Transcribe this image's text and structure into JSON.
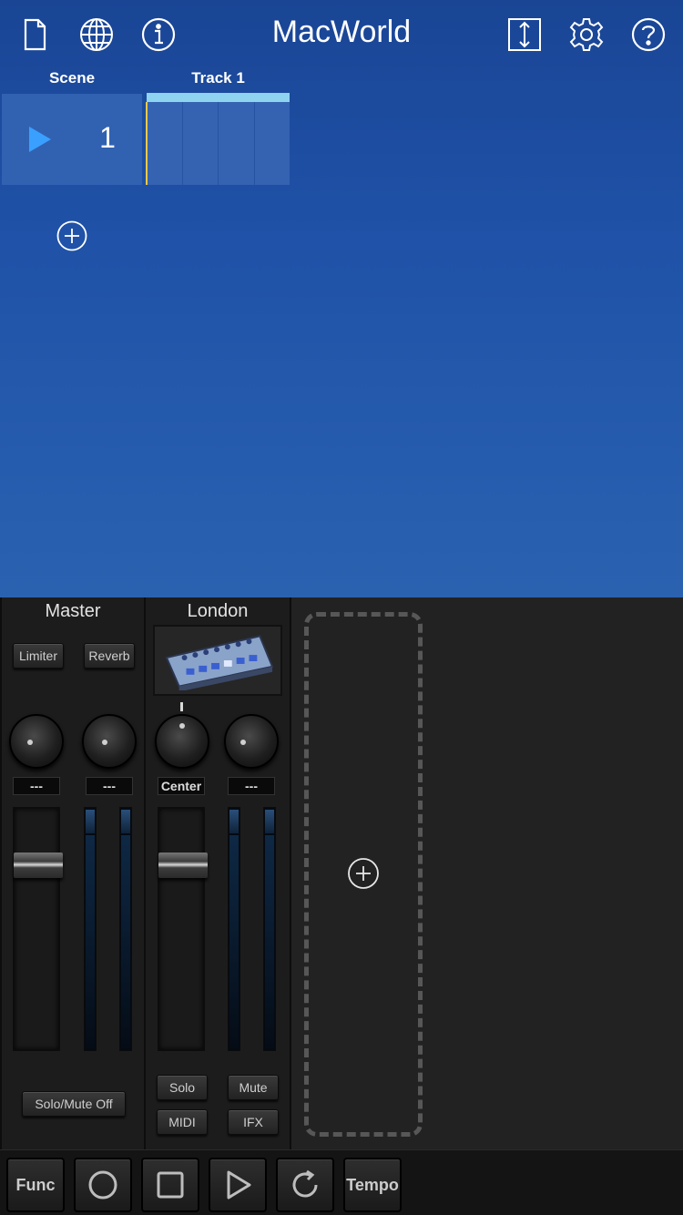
{
  "header": {
    "title": "MacWorld",
    "icons": [
      "document-icon",
      "globe-icon",
      "info-icon",
      "resize-vertical-icon",
      "gear-icon",
      "help-icon"
    ]
  },
  "arranger": {
    "scene_label": "Scene",
    "track_label": "Track 1",
    "scenes": [
      {
        "number": "1"
      }
    ]
  },
  "mixer": {
    "master": {
      "title": "Master",
      "limiter_label": "Limiter",
      "reverb_label": "Reverb",
      "readout_left": "---",
      "readout_right": "---",
      "solo_mute_off_label": "Solo/Mute Off"
    },
    "london": {
      "title": "London",
      "pan_readout": "Center",
      "send_readout": "---",
      "solo_label": "Solo",
      "mute_label": "Mute",
      "midi_label": "MIDI",
      "ifx_label": "IFX"
    }
  },
  "transport": {
    "func_label": "Func",
    "tempo_label": "Tempo",
    "icons": [
      "record-icon",
      "stop-icon",
      "play-icon",
      "loop-icon"
    ]
  },
  "colors": {
    "accent": "#3aa0ff",
    "track_bar": "#8ed3f0",
    "playhead": "#e8c94a"
  }
}
